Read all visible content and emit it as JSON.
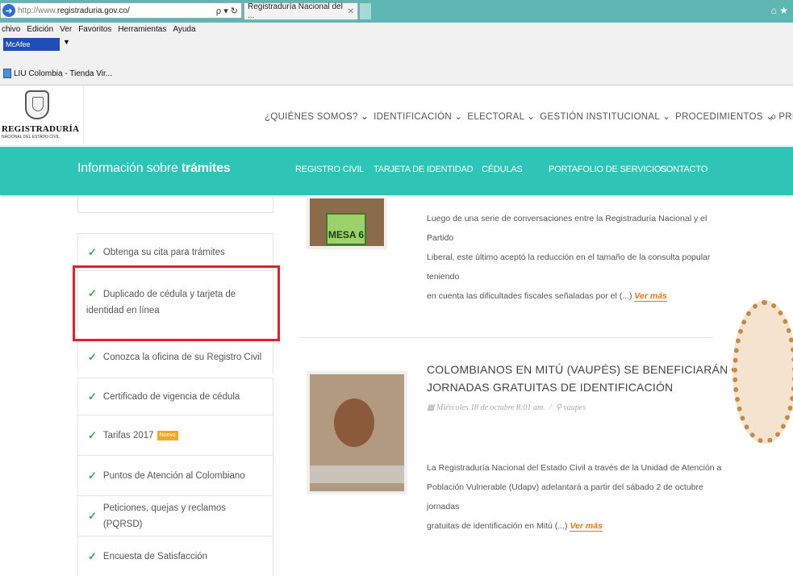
{
  "browser": {
    "url_scheme": "http://www.",
    "url_host": "registraduria.gov.co/",
    "addr_controls": "ρ ▾ ↻",
    "tab_title": "Registraduría Nacional del ...",
    "tab_close": "✕",
    "right_icons": "⌂ ★",
    "menu": [
      "chivo",
      "Edición",
      "Ver",
      "Favoritos",
      "Herramientas",
      "Ayuda"
    ],
    "mcafee_label": "McAfee",
    "favorite_label": "LIU Colombia - Tienda Vir..."
  },
  "header": {
    "logo_text": "REGISTRADURÍA",
    "logo_sub": "NACIONAL DEL ESTADO CIVIL",
    "nav": [
      "¿QUIÉNES SOMOS? ⌄",
      "IDENTIFICACIÓN ⌄",
      "ELECTORAL ⌄",
      "GESTIÓN INSTITUCIONAL ⌄",
      "PROCEDIMIENTOS ⌄",
      "PRENSA ⌄"
    ]
  },
  "teal_bar": {
    "title_plain": "Información sobre ",
    "title_bold": "trámites",
    "links": [
      "REGISTRO CIVIL",
      "TARJETA DE IDENTIDAD",
      "CÉDULAS",
      "PORTAFOLIO DE SERVICIOS",
      "CONTACTO"
    ]
  },
  "sidebar": {
    "items": [
      {
        "label": "Obtenga su cita para trámites"
      },
      {
        "label": "Duplicado de cédula y tarjeta de identidad en línea"
      },
      {
        "label": "Conozca la oficina de su Registro Civil"
      },
      {
        "label": "Certificado de vigencia de cédula"
      },
      {
        "label": "Tarifas 2017",
        "badge": "Nuevo"
      },
      {
        "label": "Puntos de Atención al Colombiano"
      },
      {
        "label": "Peticiones, quejas y reclamos (PQRSD)"
      },
      {
        "label": "Encuesta de Satisfacción"
      }
    ]
  },
  "articles": [
    {
      "image_label": "MESA 6",
      "text_lines": [
        "Luego de una serie de conversaciones entre la Registraduría Nacional y el Partido",
        "Liberal, este último aceptó la reducción en el tamaño de la consulta popular teniendo",
        "en cuenta las dificultades fiscales señaladas por el (...)"
      ],
      "more": "Ver más"
    },
    {
      "title_lines": [
        "COLOMBIANOS EN MITÚ (VAUPÉS) SE BENEFICIARÁN CON",
        "JORNADAS GRATUITAS DE IDENTIFICACIÓN"
      ],
      "date": "Miércoles 18 de octubre 8:01 am.",
      "location": "vaupes",
      "text_lines": [
        "La Registraduría Nacional del Estado Civil a través de la Unidad de Atención a",
        "Población Vulnerable (Udapv) adelantará a partir del sábado 2 de octubre jornadas",
        "gratuitas de identificación en Mitú (...)"
      ],
      "more": "Ver más"
    }
  ],
  "colors": {
    "teal": "#2ec4b6",
    "check": "#2eaf48",
    "highlight": "#e0202a",
    "link": "#e0771c"
  }
}
